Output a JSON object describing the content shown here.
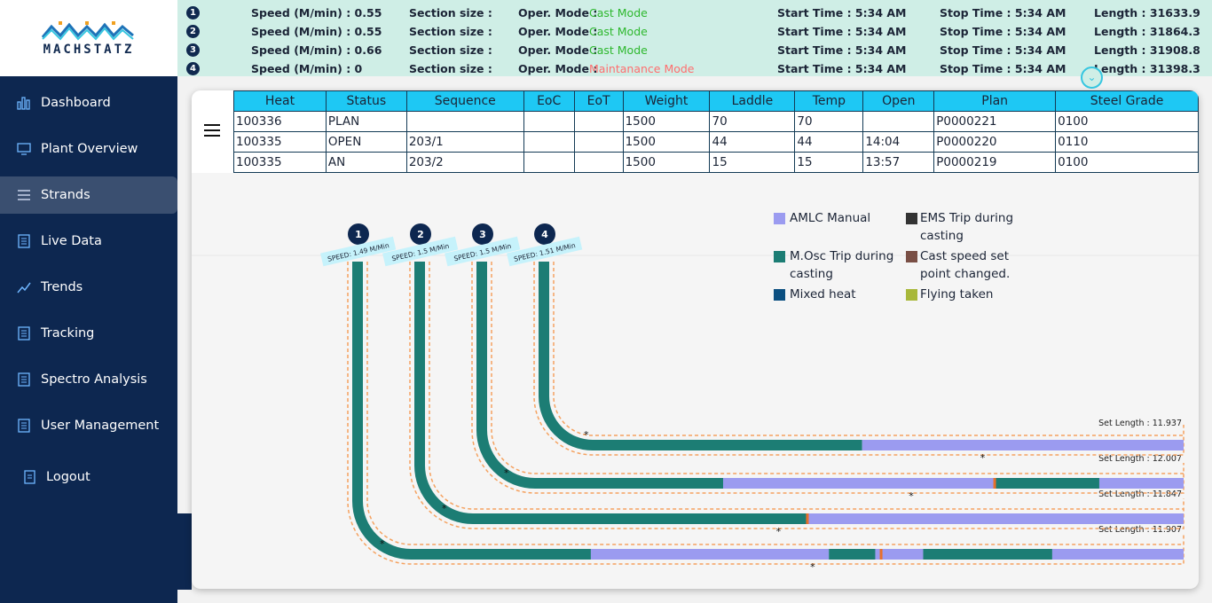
{
  "logo": {
    "text": "MACHSTATZ"
  },
  "sidebar": {
    "items": [
      {
        "label": "Dashboard",
        "icon": "bar-chart-icon"
      },
      {
        "label": "Plant Overview",
        "icon": "monitor-icon"
      },
      {
        "label": "Strands",
        "icon": "list-icon",
        "active": true
      },
      {
        "label": "Live Data",
        "icon": "document-icon"
      },
      {
        "label": "Trends",
        "icon": "trend-line-icon"
      },
      {
        "label": "Tracking",
        "icon": "document-icon"
      },
      {
        "label": "Spectro Analysis",
        "icon": "document-icon"
      },
      {
        "label": "User Management",
        "icon": "document-icon"
      },
      {
        "label": "Logout",
        "icon": "logout-icon"
      }
    ]
  },
  "status": {
    "rows": [
      {
        "num": "1",
        "speed": "Speed (M/min) : 0.55",
        "section": "Section size :",
        "mode_label": "Oper. Mode :",
        "mode": "Cast Mode",
        "mode_type": "cast",
        "start": "Start Time : 5:34 AM",
        "stop": "Stop Time : 5:34 AM",
        "length": "Length : 31633.9"
      },
      {
        "num": "2",
        "speed": "Speed (M/min) : 0.55",
        "section": "Section size :",
        "mode_label": "Oper. Mode :",
        "mode": "Cast Mode",
        "mode_type": "cast",
        "start": "Start Time : 5:34 AM",
        "stop": "Stop Time : 5:34 AM",
        "length": "Length : 31864.3"
      },
      {
        "num": "3",
        "speed": "Speed (M/min) : 0.66",
        "section": "Section size :",
        "mode_label": "Oper. Mode :",
        "mode": "Cast Mode",
        "mode_type": "cast",
        "start": "Start Time : 5:34 AM",
        "stop": "Stop Time : 5:34 AM",
        "length": "Length : 31908.8"
      },
      {
        "num": "4",
        "speed": "Speed (M/min) : 0",
        "section": "Section size :",
        "mode_label": "Oper. Mode :",
        "mode": "Maintanance Mode",
        "mode_type": "maint",
        "start": "Start Time : 5:34 AM",
        "stop": "Stop Time : 5:34 AM",
        "length": "Length : 31398.3"
      }
    ],
    "colors": {
      "cast": "#2eb82e",
      "maint": "#ff6e6e"
    }
  },
  "heat_table": {
    "headers": [
      "Heat",
      "Status",
      "Sequence",
      "EoC",
      "EoT",
      "Weight",
      "Laddle",
      "Temp",
      "Open",
      "Plan",
      "Steel Grade"
    ],
    "rows": [
      [
        "100336",
        "PLAN",
        "",
        "",
        "",
        "1500",
        "70",
        "70",
        "",
        "P0000221",
        "0100"
      ],
      [
        "100335",
        "OPEN",
        "203/1",
        "",
        "",
        "1500",
        "44",
        "44",
        "14:04",
        "P0000220",
        "0110"
      ],
      [
        "100335",
        "AN",
        "203/2",
        "",
        "",
        "1500",
        "15",
        "15",
        "13:57",
        "P0000219",
        "0100"
      ]
    ]
  },
  "legend": [
    {
      "label": "AMLC Manual",
      "color": "#9b9bf0"
    },
    {
      "label": "EMS Trip during casting",
      "color": "#333333"
    },
    {
      "label": "M.Osc Trip during casting",
      "color": "#1c7d74"
    },
    {
      "label": "Cast speed set point changed.",
      "color": "#7a4f45"
    },
    {
      "label": "Mixed heat",
      "color": "#0b4f80"
    },
    {
      "label": "Flying taken",
      "color": "#a8b83a"
    }
  ],
  "strands": [
    {
      "num": "1",
      "speed_label": "SPEED: 1.49 M/Min",
      "set_length": "Set Length : 11.907"
    },
    {
      "num": "2",
      "speed_label": "SPEED: 1.5 M/Min",
      "set_length": "Set Length : 11.847"
    },
    {
      "num": "3",
      "speed_label": "SPEED: 1.5 M/Min",
      "set_length": "Set Length : 12.007"
    },
    {
      "num": "4",
      "speed_label": "SPEED: 1.51 M/Min",
      "set_length": "Set Length : 11.937"
    }
  ],
  "colors": {
    "sidebar": "#0d2750",
    "header_cyan": "#1ec8f4",
    "strand_teal": "#1c7d74",
    "strand_purple": "#9b9bf0",
    "guide_orange": "#f5a260",
    "marker_orange": "#e8702a"
  }
}
